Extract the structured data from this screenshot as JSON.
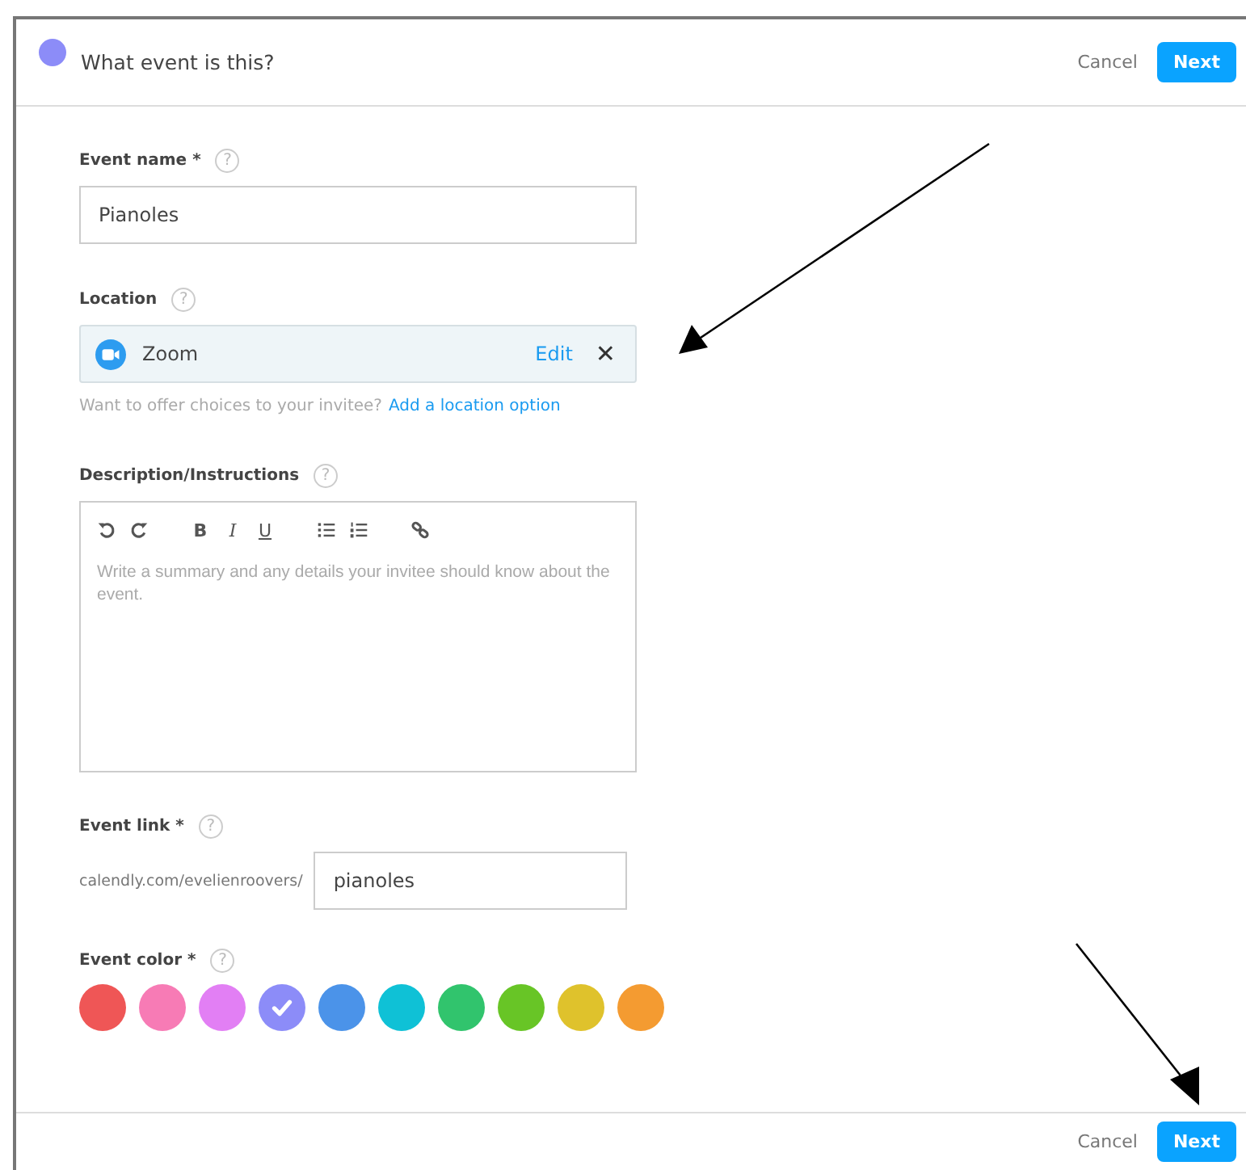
{
  "header": {
    "title": "What event is this?",
    "cancel": "Cancel",
    "next": "Next"
  },
  "event_name": {
    "label": "Event name *",
    "help": "?",
    "value": "Pianoles"
  },
  "location": {
    "label": "Location",
    "help": "?",
    "value": "Zoom",
    "edit": "Edit",
    "remove": "✕",
    "hint": "Want to offer choices to your invitee?",
    "link": "Add a location option"
  },
  "description": {
    "label": "Description/Instructions",
    "help": "?",
    "placeholder": "Write a summary and any details your invitee should know about the event.",
    "toolbar": [
      {
        "kind": "undo"
      },
      {
        "kind": "redo"
      },
      {
        "kind": "bold",
        "text": "B"
      },
      {
        "kind": "italic",
        "text": "I"
      },
      {
        "kind": "underline",
        "text": "U"
      },
      {
        "kind": "bullets"
      },
      {
        "kind": "numbers"
      },
      {
        "kind": "link"
      }
    ]
  },
  "event_link": {
    "label": "Event link *",
    "help": "?",
    "prefix": "calendly.com/evelienroovers/",
    "value": "pianoles"
  },
  "event_color": {
    "label": "Event color *",
    "help": "?",
    "colors": [
      {
        "color": "#ef5656",
        "selected": false
      },
      {
        "color": "#f77bb5",
        "selected": false
      },
      {
        "color": "#e27ff4",
        "selected": false
      },
      {
        "color": "#8c8cf8",
        "selected": true
      },
      {
        "color": "#4b93e9",
        "selected": false
      },
      {
        "color": "#0fc1d6",
        "selected": false
      },
      {
        "color": "#31c46d",
        "selected": false
      },
      {
        "color": "#68c526",
        "selected": false
      },
      {
        "color": "#dfc22c",
        "selected": false
      },
      {
        "color": "#f49b31",
        "selected": false
      }
    ]
  },
  "footer": {
    "cancel": "Cancel",
    "next": "Next"
  }
}
